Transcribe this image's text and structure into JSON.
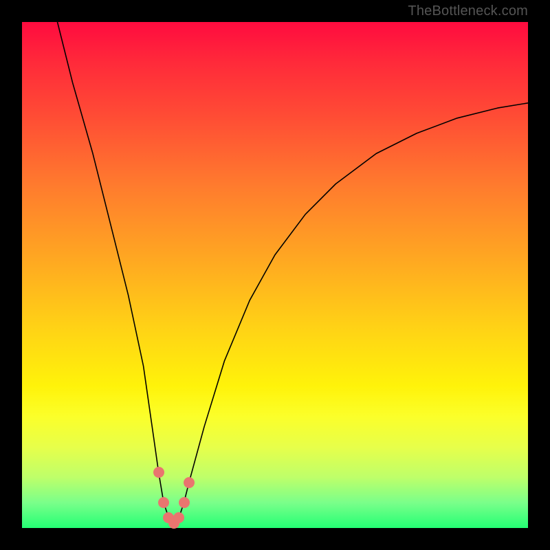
{
  "attribution": "TheBottleneck.com",
  "colors": {
    "curve": "#000000",
    "markers": "#e9756f",
    "gradient_top": "#ff0b3f",
    "gradient_bottom": "#24ff74"
  },
  "chart_data": {
    "type": "line",
    "title": "",
    "xlabel": "",
    "ylabel": "",
    "xlim": [
      0,
      100
    ],
    "ylim": [
      0,
      100
    ],
    "grid": false,
    "legend": false,
    "series": [
      {
        "name": "curve",
        "x": [
          7,
          10,
          14,
          18,
          21,
          24,
          26,
          27,
          28,
          29,
          30,
          31,
          32,
          33,
          36,
          40,
          45,
          50,
          56,
          62,
          70,
          78,
          86,
          94,
          100
        ],
        "y": [
          100,
          88,
          74,
          58,
          46,
          32,
          18,
          11,
          5,
          2,
          1,
          2,
          5,
          9,
          20,
          33,
          45,
          54,
          62,
          68,
          74,
          78,
          81,
          83,
          84
        ]
      }
    ],
    "markers": {
      "name": "bottom-cluster",
      "color": "#e9756f",
      "points": [
        {
          "x": 27,
          "y": 11
        },
        {
          "x": 28,
          "y": 5
        },
        {
          "x": 29,
          "y": 2
        },
        {
          "x": 30,
          "y": 1
        },
        {
          "x": 31,
          "y": 2
        },
        {
          "x": 32,
          "y": 5
        },
        {
          "x": 33,
          "y": 9
        }
      ]
    }
  }
}
